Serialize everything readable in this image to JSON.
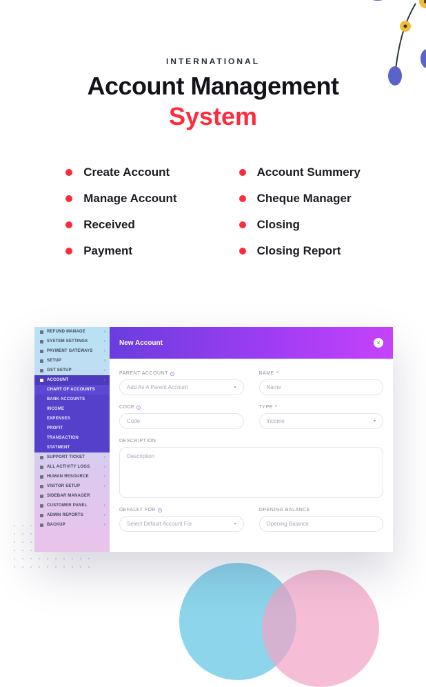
{
  "hero": {
    "eyebrow": "INTERNATIONAL",
    "title_line1": "Account Management",
    "title_line2": "System"
  },
  "features_left": [
    "Create Account",
    "Manage Account",
    "Received",
    "Payment"
  ],
  "features_right": [
    "Account Summery",
    "Cheque Manager",
    "Closing",
    "Closing Report"
  ],
  "sidebar": {
    "items": [
      {
        "label": "REFUND MANAGE",
        "icon": true,
        "caret": true
      },
      {
        "label": "SYSTEM SETTINGS",
        "icon": true,
        "caret": true
      },
      {
        "label": "PAYMENT GATEWAYS",
        "icon": true,
        "caret": true
      },
      {
        "label": "SETUP",
        "icon": true,
        "caret": true
      },
      {
        "label": "GST SETUP",
        "icon": true,
        "caret": true
      }
    ],
    "active_group": "ACCOUNT",
    "sub_items": [
      "CHART OF ACCOUNTS",
      "BANK ACCOUNTS",
      "INCOME",
      "EXPENSES",
      "PROFIT",
      "TRANSACTION",
      "STATMENT"
    ],
    "items_after": [
      {
        "label": "SUPPORT TICKET",
        "icon": true,
        "caret": true
      },
      {
        "label": "ALL ACTIVITY LOGS",
        "icon": true,
        "caret": true
      },
      {
        "label": "HUMAN RESOURCE",
        "icon": true,
        "caret": true
      },
      {
        "label": "VISITOR SETUP",
        "icon": true,
        "caret": true
      },
      {
        "label": "SIDEBAR MANAGER",
        "icon": true
      },
      {
        "label": "CUSTOMER PANEL",
        "icon": true,
        "caret": true
      },
      {
        "label": "ADMIN REPORTS",
        "icon": true,
        "caret": true
      },
      {
        "label": "BACKUP",
        "icon": true,
        "caret": true
      }
    ]
  },
  "modal": {
    "title": "New Account",
    "labels": {
      "parent": "PARENT ACCOUNT",
      "name": "NAME",
      "code": "CODE",
      "type": "TYPE",
      "description": "DESCRIPTION",
      "default_for": "DEFAULT FOR",
      "opening_balance": "OPENING BALANCE"
    },
    "placeholders": {
      "parent": "Add As A Parent Account",
      "name": "Name",
      "code": "Code",
      "type": "Income",
      "description": "Description",
      "default_for": "Select Default Account For",
      "opening_balance": "Opening Balance"
    }
  }
}
